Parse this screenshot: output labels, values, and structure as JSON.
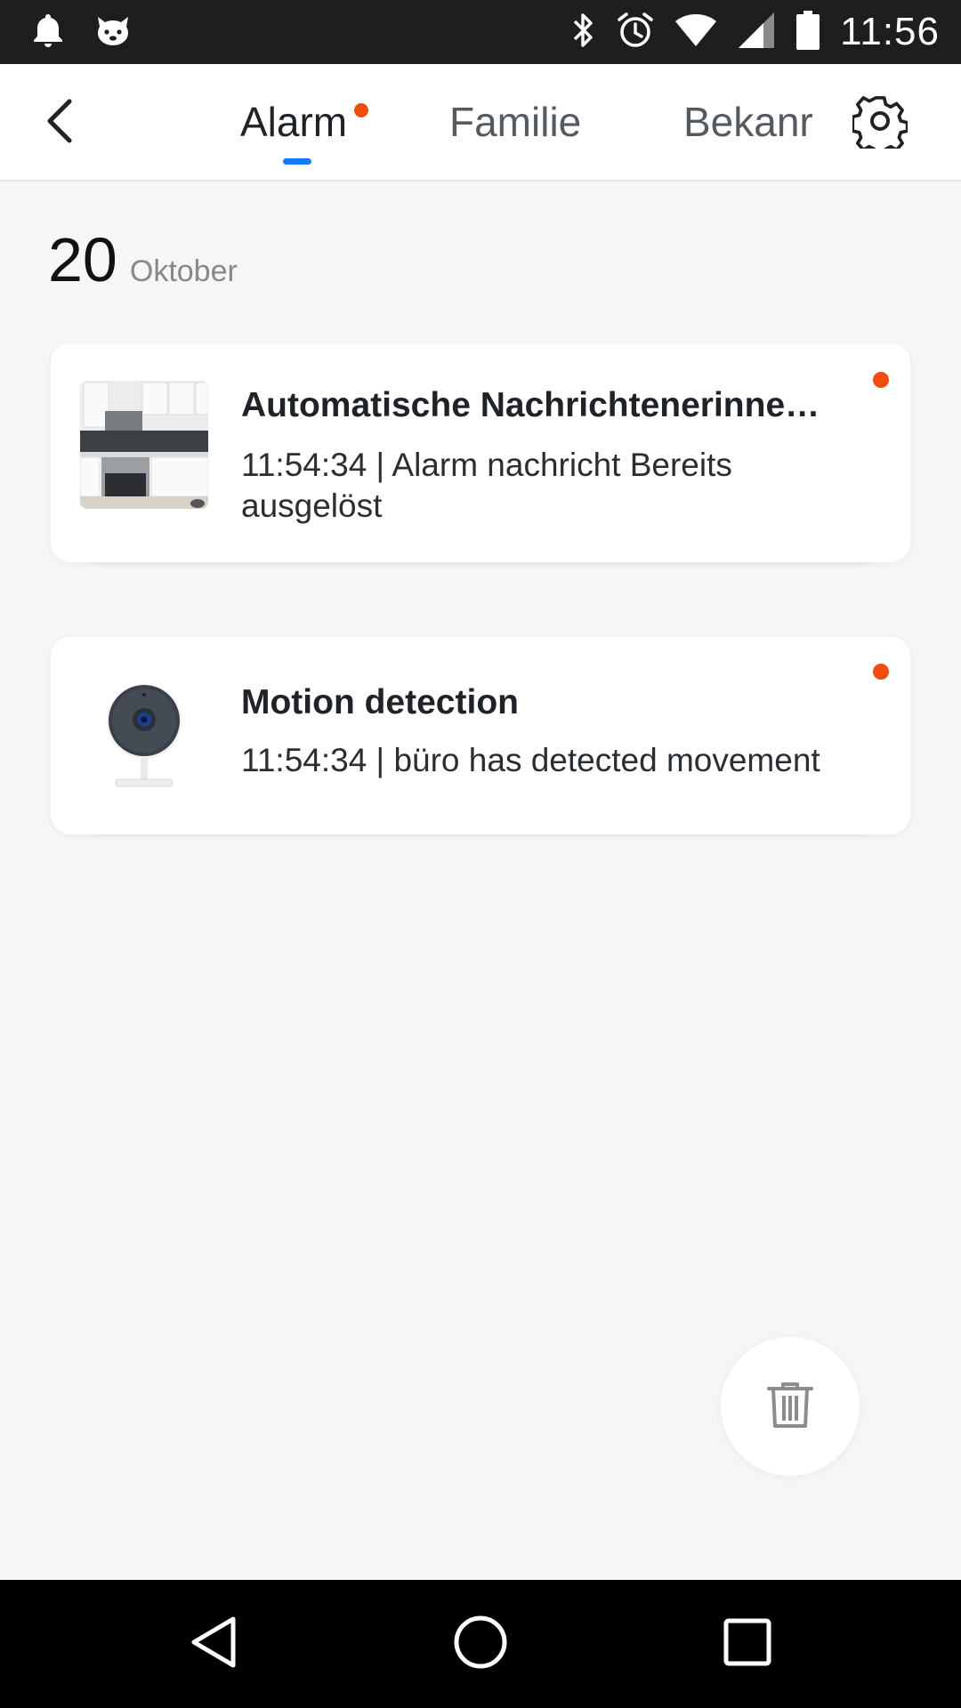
{
  "status_bar": {
    "time": "11:56",
    "icons": [
      "notification-bell-icon",
      "app-mascot-icon",
      "bluetooth-icon",
      "alarm-clock-icon",
      "wifi-icon",
      "cell-signal-icon",
      "battery-icon"
    ]
  },
  "header": {
    "back_icon": "chevron-left-icon",
    "tabs": [
      {
        "label": "Alarm",
        "active": true,
        "has_unread": true
      },
      {
        "label": "Familie",
        "active": false
      },
      {
        "label": "Bekanr",
        "active": false
      }
    ],
    "settings_icon": "gear-icon"
  },
  "date": {
    "day": "20",
    "month": "Oktober"
  },
  "messages": [
    {
      "title": "Automatische Nachrichtenerinne…",
      "description": "11:54:34 | Alarm nachricht Bereits ausgelöst",
      "thumbnail": "kitchen-photo",
      "unread": true
    },
    {
      "title": "Motion detection",
      "description": "11:54:34 | büro has detected movement",
      "thumbnail": "security-camera-icon",
      "unread": true
    }
  ],
  "fab": {
    "icon": "trash-icon"
  },
  "nav_bar": {
    "icons": [
      "nav-back-icon",
      "nav-home-icon",
      "nav-recents-icon"
    ]
  },
  "colors": {
    "accent": "#1677ff",
    "unread": "#f04c0d",
    "background": "#f6f6f6"
  }
}
